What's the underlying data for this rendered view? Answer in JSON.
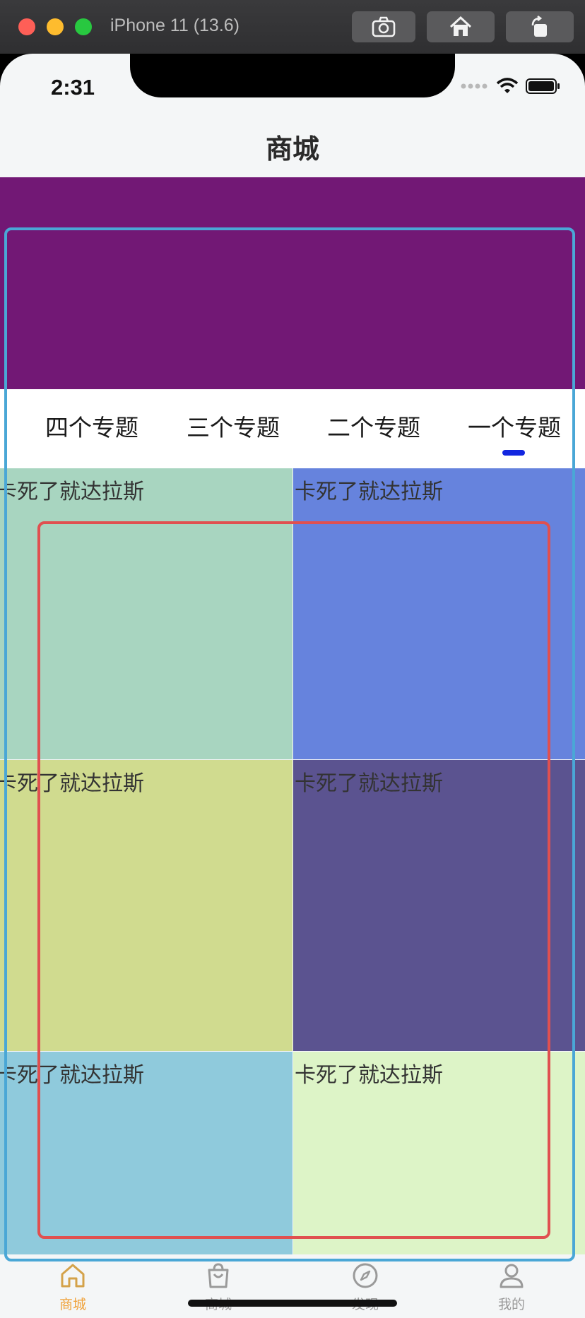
{
  "simulator": {
    "title": "iPhone 11 (13.6)"
  },
  "status_bar": {
    "time": "2:31"
  },
  "nav": {
    "title": "商城"
  },
  "banner": {
    "color": "#721875"
  },
  "tabs": [
    {
      "label": "四个专题"
    },
    {
      "label": "三个专题"
    },
    {
      "label": "二个专题"
    },
    {
      "label": "一个专题",
      "active": true
    }
  ],
  "grid": [
    {
      "text": "卡死了就达拉斯",
      "color": "#a8d5c0"
    },
    {
      "text": "卡死了就达拉斯",
      "color": "#6683dd"
    },
    {
      "text": "卡死了就达拉斯",
      "color": "#d0db8f"
    },
    {
      "text": "卡死了就达拉斯",
      "color": "#5b5390"
    },
    {
      "text": "卡死了就达拉斯",
      "color": "#8fcadc"
    },
    {
      "text": "卡死了就达拉斯",
      "color": "#ddf4c7"
    }
  ],
  "tabbar": [
    {
      "label": "商城",
      "icon": "home-icon",
      "active": true
    },
    {
      "label": "商城",
      "icon": "bag-icon"
    },
    {
      "label": "发现",
      "icon": "compass-icon"
    },
    {
      "label": "我的",
      "icon": "user-icon"
    }
  ],
  "colors": {
    "accent": "#f0a23a",
    "tab_indicator": "#1226e0",
    "annotation_blue": "#4aa7d6",
    "annotation_red": "#e05050"
  }
}
